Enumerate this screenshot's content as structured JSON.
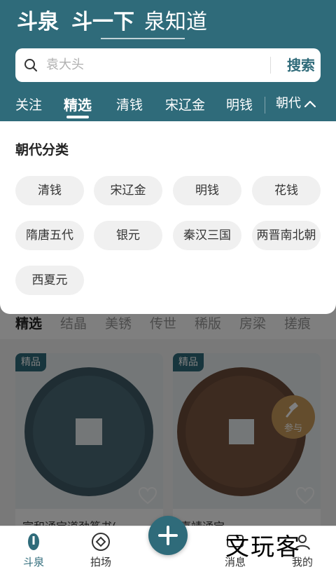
{
  "header": {
    "logo_text": "斗泉",
    "slogan": "斗一下",
    "slogan2": "泉知道",
    "bg_color": "#2f6b7a"
  },
  "search": {
    "placeholder": "袁大头",
    "button_label": "搜索",
    "icon": "search-icon"
  },
  "tabs": [
    "关注",
    "精选",
    "清钱",
    "宋辽金",
    "明钱"
  ],
  "active_tab": "精选",
  "category_toggle": {
    "label": "朝代",
    "icon": "chevron-up-icon"
  },
  "panel": {
    "title": "朝代分类",
    "chips": [
      "清钱",
      "宋辽金",
      "明钱",
      "花钱",
      "隋唐五代",
      "银元",
      "秦汉三国",
      "两晋南北朝",
      "西夏元"
    ]
  },
  "subtabs": [
    "精选",
    "结晶",
    "美锈",
    "传世",
    "稀版",
    "房梁",
    "搓痕"
  ],
  "active_subtab": "精选",
  "cards": [
    {
      "badge": "精品",
      "title": "宣和通宝道劲篆书(…",
      "icon": "heart-icon"
    },
    {
      "badge": "精品",
      "title": "嘉靖通宝…",
      "bid_label": "参与",
      "icon": "heart-icon"
    }
  ],
  "bottom_nav": [
    {
      "label": "斗泉",
      "icon": "doquan-icon",
      "active": true
    },
    {
      "label": "拍场",
      "icon": "auction-icon",
      "active": false
    },
    {
      "label": "",
      "icon": "plus-icon",
      "active": false
    },
    {
      "label": "消息",
      "icon": "message-icon",
      "active": false
    },
    {
      "label": "我的",
      "icon": "profile-icon",
      "active": false
    }
  ],
  "watermark": "文玩客",
  "colors": {
    "accent": "#2f6b7a",
    "chip_bg": "#f0f0f0",
    "bid": "#c99a5a"
  }
}
